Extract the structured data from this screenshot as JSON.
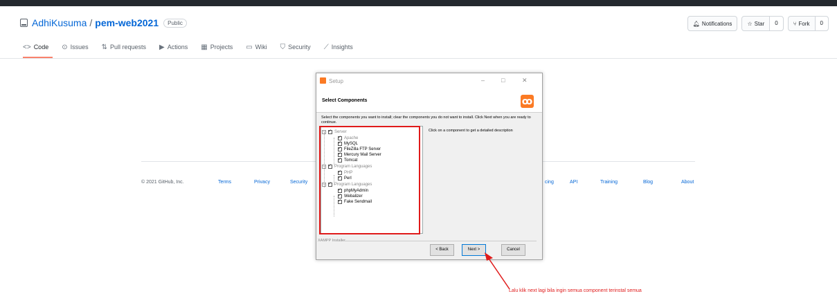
{
  "repo": {
    "owner": "AdhiKusuma",
    "separator": "/",
    "name": "pem-web2021",
    "visibility": "Public"
  },
  "header_actions": {
    "notifications": "Notifications",
    "star_label": "Star",
    "star_count": "0",
    "fork_label": "Fork",
    "fork_count": "0"
  },
  "tabs": [
    {
      "label": "Code",
      "icon": "code-icon",
      "glyph": "<>"
    },
    {
      "label": "Issues",
      "icon": "issue-icon",
      "glyph": "⊙"
    },
    {
      "label": "Pull requests",
      "icon": "pull-request-icon",
      "glyph": "⇅"
    },
    {
      "label": "Actions",
      "icon": "play-icon",
      "glyph": "▶"
    },
    {
      "label": "Projects",
      "icon": "project-icon",
      "glyph": "▦"
    },
    {
      "label": "Wiki",
      "icon": "book-icon",
      "glyph": "▭"
    },
    {
      "label": "Security",
      "icon": "shield-icon",
      "glyph": "⛉"
    },
    {
      "label": "Insights",
      "icon": "graph-icon",
      "glyph": "⟋"
    }
  ],
  "footer": {
    "copyright": "© 2021 GitHub, Inc.",
    "terms": "Terms",
    "privacy": "Privacy",
    "security": "Security",
    "pricing_partial": "cing",
    "api": "API",
    "training": "Training",
    "blog": "Blog",
    "about": "About"
  },
  "dialog": {
    "title": "Setup",
    "minimize": "–",
    "maximize": "□",
    "close": "✕",
    "heading": "Select Components",
    "instructions": "Select the components you want to install; clear the components you do not want to install. Click Next when you are ready to continue.",
    "description_hint": "Click on a component to get a detailed description",
    "tree": {
      "server": "Server",
      "apache": "Apache",
      "mysql": "MySQL",
      "filezilla": "FileZilla FTP Server",
      "mercury": "Mercury Mail Server",
      "tomcat": "Tomcat",
      "program_languages_1": "Program Languages",
      "php": "PHP",
      "perl": "Perl",
      "program_languages_2": "Program Languages",
      "phpmyadmin": "phpMyAdmin",
      "webalizer": "Webalizer",
      "fake_sendmail": "Fake Sendmail"
    },
    "installer_label": "XAMPP Installer",
    "back": "< Back",
    "next": "Next >",
    "cancel": "Cancel"
  },
  "annotation": {
    "note": "Lalu klik next lagi bila ingin semua component terinstal semua",
    "color": "#e01a1a"
  }
}
